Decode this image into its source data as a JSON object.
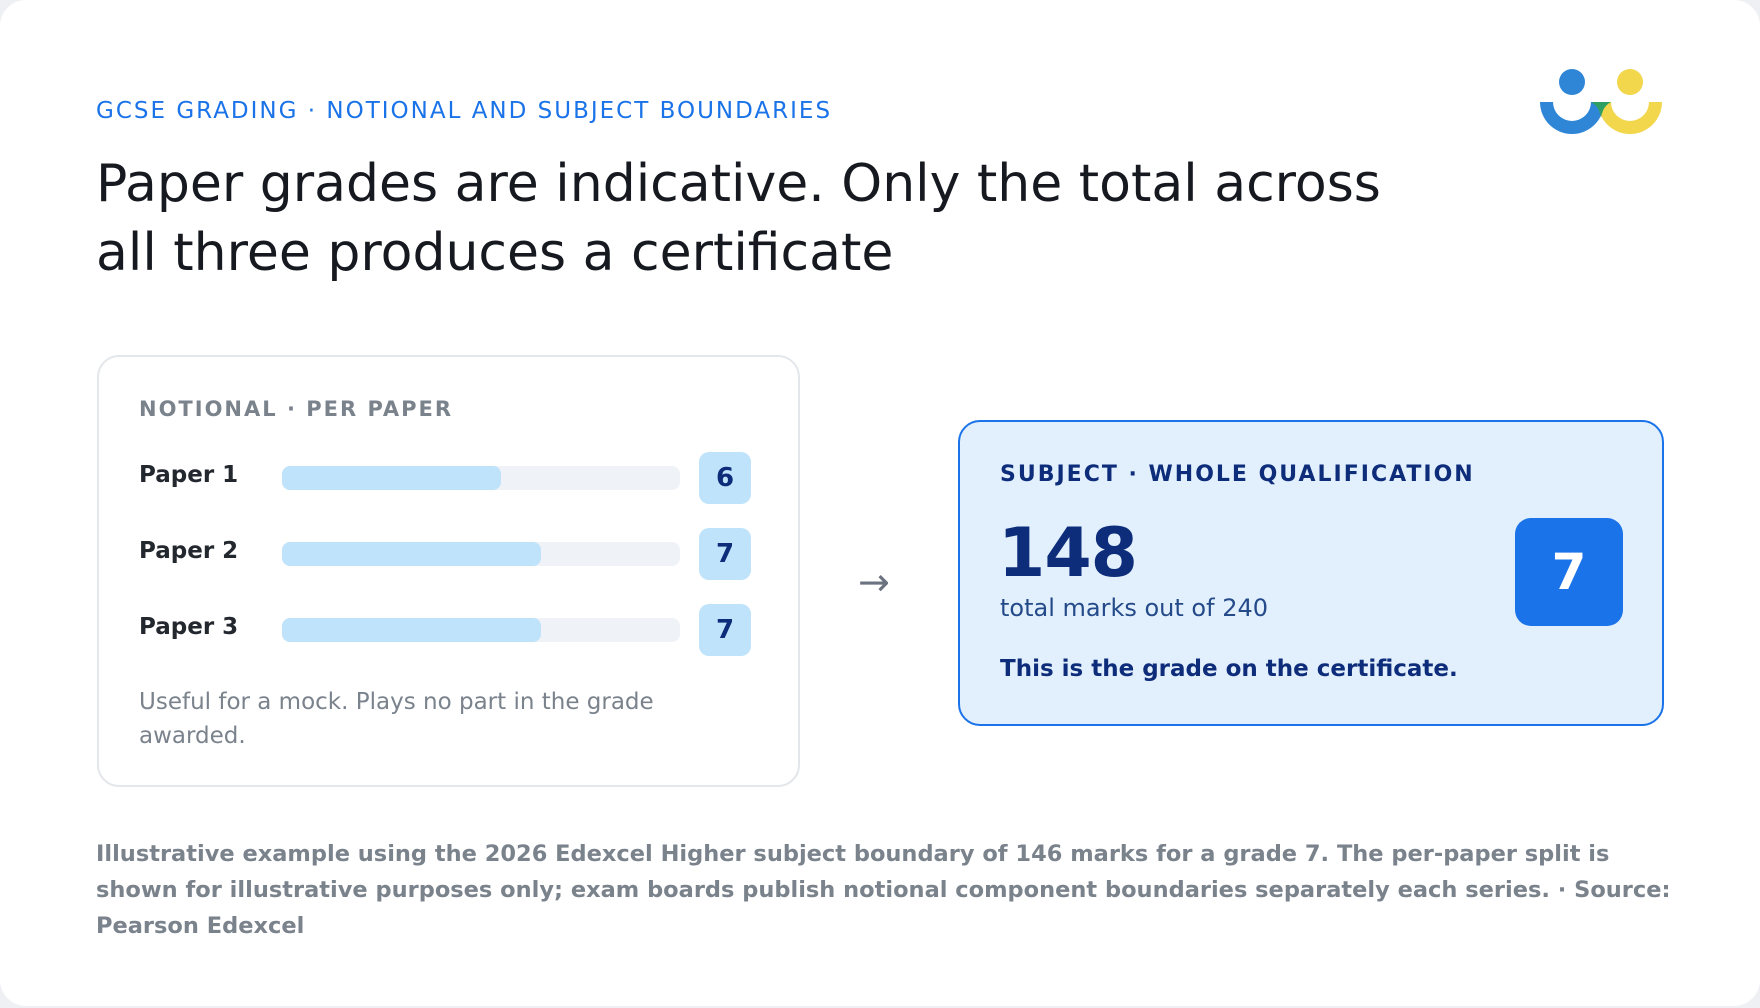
{
  "eyebrow": "GCSE GRADING · NOTIONAL AND SUBJECT BOUNDARIES",
  "headline": "Paper grades are indicative. Only the total across all three produces a certificate",
  "logo": {
    "icon": "people-logo-icon",
    "colors": [
      "#2f86d6",
      "#2e9e63",
      "#f2d64b"
    ]
  },
  "notional_panel": {
    "label": "NOTIONAL · PER PAPER",
    "note": "Useful for a mock. Plays no part in the grade awarded."
  },
  "arrow": "→",
  "subject_panel": {
    "label": "SUBJECT · WHOLE QUALIFICATION",
    "total_marks": "148",
    "total_caption": "total marks out of 240",
    "grade": "7",
    "certificate_note": "This is the grade on the certificate."
  },
  "footnote": "Illustrative example using the 2026 Edexcel Higher subject boundary of 146 marks for a grade 7. The per-paper split is shown for illustrative purposes only; exam boards publish notional component boundaries separately each series. · Source: Pearson Edexcel",
  "colors": {
    "accent": "#1a73e8",
    "bar_fill": "#bfe3fb",
    "bar_track": "#eff2f6",
    "dark_navy": "#0d2c7a",
    "subject_panel_bg": "#e2f0fd"
  },
  "chart_data": {
    "type": "bar",
    "orientation": "horizontal",
    "categories": [
      "Paper 1",
      "Paper 2",
      "Paper 3"
    ],
    "values": [
      0.55,
      0.65,
      0.65
    ],
    "value_scale": "fraction of bar track filled",
    "grades": [
      "6",
      "7",
      "7"
    ]
  }
}
